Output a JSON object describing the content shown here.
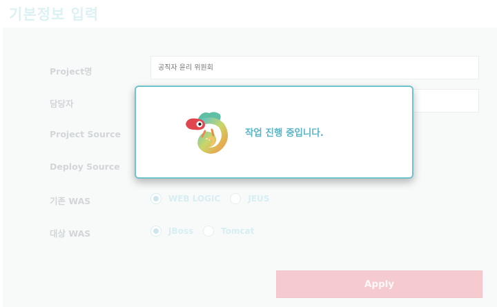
{
  "page": {
    "title": "기본정보 입력"
  },
  "form": {
    "project_name": {
      "label": "Project명",
      "placeholder": "공직자 윤리 위원회"
    },
    "manager": {
      "label": "담당자",
      "value": ""
    },
    "project_source": {
      "label": "Project Source"
    },
    "deploy_source": {
      "label": "Deploy Source"
    },
    "current_was": {
      "label": "기존 WAS",
      "options": [
        {
          "label": "WEB LOGIC",
          "checked": true
        },
        {
          "label": "JEUS",
          "checked": false
        }
      ]
    },
    "target_was": {
      "label": "대상 WAS",
      "options": [
        {
          "label": "JBoss",
          "checked": true
        },
        {
          "label": "Tomcat",
          "checked": false
        }
      ]
    },
    "apply_label": "Apply"
  },
  "modal": {
    "message": "작업 진행 중입니다."
  },
  "colors": {
    "accent": "#6ec2cc",
    "apply": "#f6cbd0",
    "logo_red": "#e0464d"
  }
}
